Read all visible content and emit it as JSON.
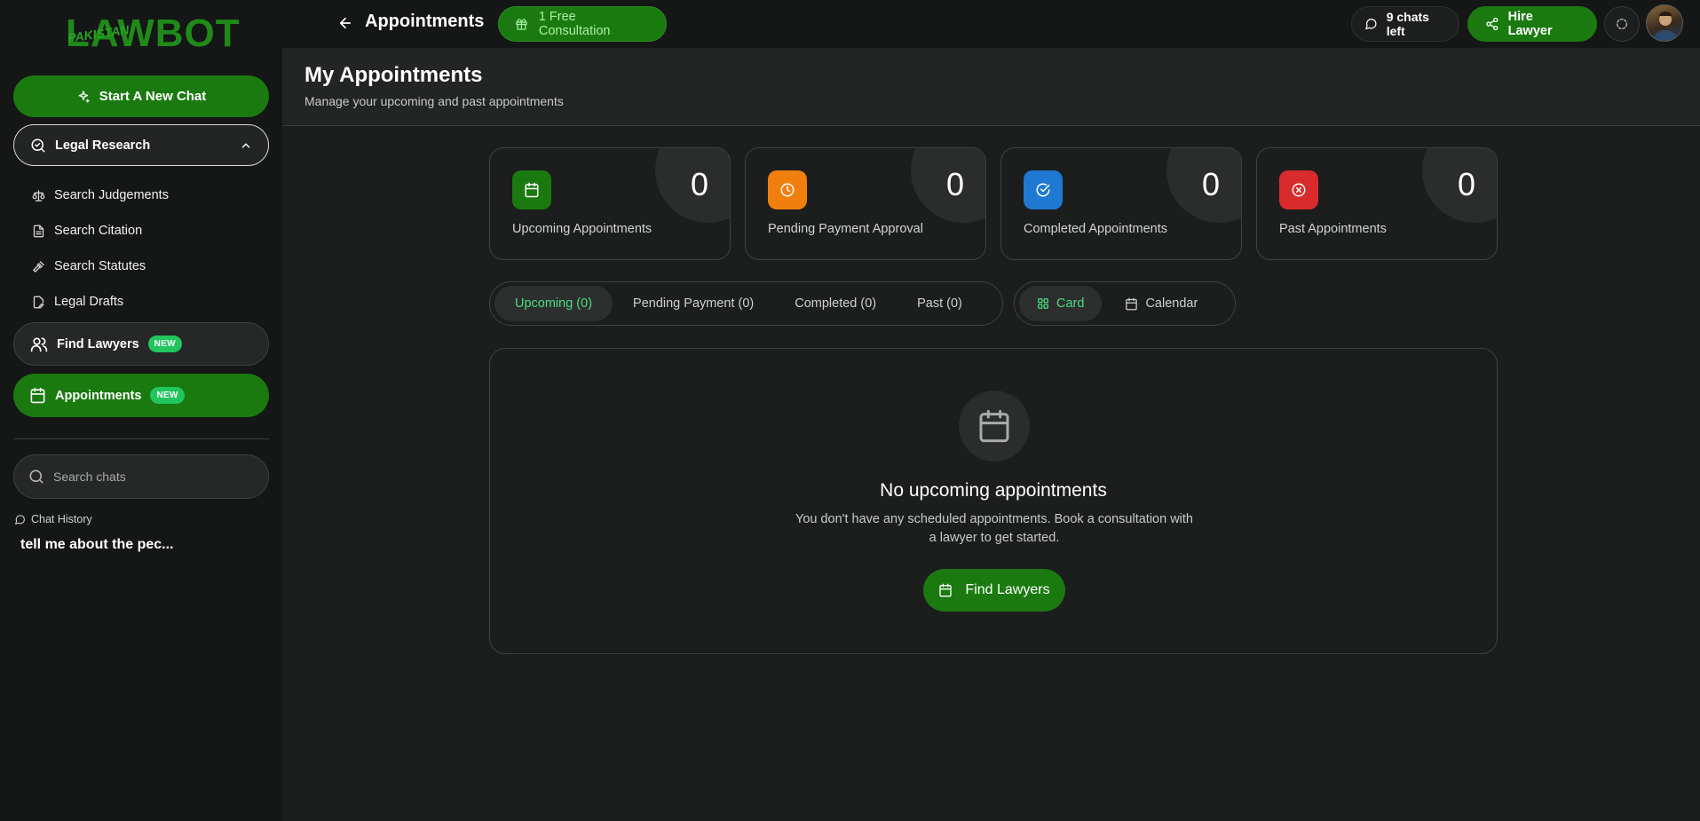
{
  "brand": {
    "logo_word": "LAWBOT",
    "logo_sub": "PAKISTAN"
  },
  "sidebar": {
    "new_chat_label": "Start A New Chat",
    "legal_research_label": "Legal Research",
    "sub_items": [
      {
        "label": "Search Judgements",
        "icon": "scale-icon"
      },
      {
        "label": "Search Citation",
        "icon": "document-icon"
      },
      {
        "label": "Search Statutes",
        "icon": "gavel-icon"
      },
      {
        "label": "Legal Drafts",
        "icon": "edit-document-icon"
      }
    ],
    "find_lawyers_label": "Find Lawyers",
    "appointments_label": "Appointments",
    "new_badge": "NEW",
    "search_placeholder": "Search chats",
    "chat_history_label": "Chat History",
    "chat_items": [
      "tell me about the pec..."
    ]
  },
  "topbar": {
    "title": "Appointments",
    "free_consult_label": "1 Free Consultation",
    "chats_left_label": "9 chats left",
    "hire_lawyer_label": "Hire Lawyer"
  },
  "header": {
    "title": "My Appointments",
    "subtitle": "Manage your upcoming and past appointments"
  },
  "stats": [
    {
      "label": "Upcoming Appointments",
      "count": "0",
      "color": "#1a7a10",
      "icon": "calendar-icon"
    },
    {
      "label": "Pending Payment Approval",
      "count": "0",
      "color": "#f07f0e",
      "icon": "clock-icon"
    },
    {
      "label": "Completed Appointments",
      "count": "0",
      "color": "#1f78d1",
      "icon": "check-circle-icon"
    },
    {
      "label": "Past Appointments",
      "count": "0",
      "color": "#d92b2b",
      "icon": "x-circle-icon"
    }
  ],
  "tabs": [
    {
      "label": "Upcoming (0)",
      "active": true
    },
    {
      "label": "Pending Payment (0)",
      "active": false
    },
    {
      "label": "Completed (0)",
      "active": false
    },
    {
      "label": "Past (0)",
      "active": false
    }
  ],
  "view": {
    "card_label": "Card",
    "calendar_label": "Calendar"
  },
  "empty_state": {
    "title": "No upcoming appointments",
    "message": "You don't have any scheduled appointments. Book a consultation with a lawyer to get started.",
    "button_label": "Find Lawyers"
  },
  "colors": {
    "accent": "#1a7a10",
    "accent_text": "#4ade80",
    "badge": "#22c55e",
    "background": "#1c1d1d",
    "sidebar": "#151616"
  }
}
